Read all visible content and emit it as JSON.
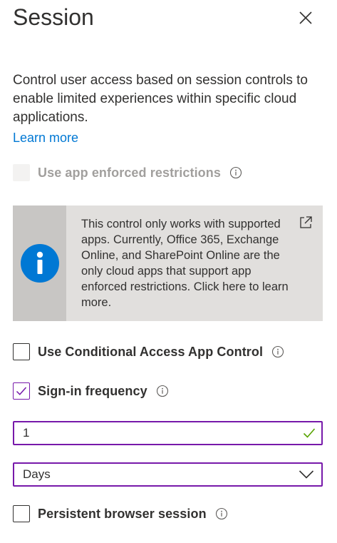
{
  "panel": {
    "title": "Session",
    "description": "Control user access based on session controls to enable limited experiences within specific cloud applications.",
    "learn_more": "Learn more"
  },
  "options": {
    "app_enforced": {
      "label": "Use app enforced restrictions",
      "checked": false,
      "disabled": true
    },
    "conditional_access": {
      "label": "Use Conditional Access App Control",
      "checked": false
    },
    "sign_in_frequency": {
      "label": "Sign-in frequency",
      "checked": true,
      "value": "1",
      "unit": "Days"
    },
    "persistent_session": {
      "label": "Persistent browser session",
      "checked": false
    }
  },
  "info_box": {
    "text": "This control only works with supported apps. Currently, Office 365, Exchange Online, and SharePoint Online are the only cloud apps that support app enforced restrictions. Click here to learn more."
  },
  "icons": {
    "close": "close-icon",
    "info": "info-icon",
    "external_link": "external-link-icon",
    "valid": "checkmark-icon",
    "chevron": "chevron-down-icon"
  },
  "colors": {
    "accent": "#7719aa",
    "link": "#0078d4",
    "info_badge": "#0078d4",
    "valid": "#57a300",
    "disabled_text": "#a19f9d"
  }
}
